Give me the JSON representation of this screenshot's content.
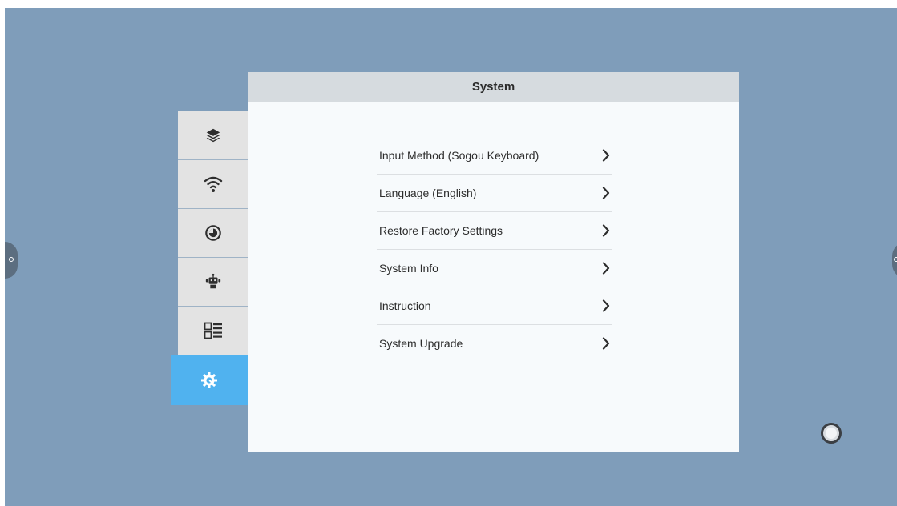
{
  "panel": {
    "title": "System"
  },
  "sidebar": {
    "items": [
      {
        "icon": "layers-icon",
        "active": false
      },
      {
        "icon": "wifi-icon",
        "active": false
      },
      {
        "icon": "clock-icon",
        "active": false
      },
      {
        "icon": "robot-icon",
        "active": false
      },
      {
        "icon": "list-layout-icon",
        "active": false
      },
      {
        "icon": "settings-gear-icon",
        "active": true
      }
    ]
  },
  "menu": {
    "items": [
      {
        "label": "Input Method (Sogou Keyboard)"
      },
      {
        "label": "Language (English)"
      },
      {
        "label": "Restore Factory Settings"
      },
      {
        "label": "System Info"
      },
      {
        "label": "Instruction"
      },
      {
        "label": "System Upgrade"
      }
    ]
  },
  "colors": {
    "desktop": "#7f9dba",
    "active_tab": "#50b2ef",
    "tab_bg": "#e3e3e3",
    "header_bg": "#d6dbdf",
    "panel_bg": "#f7fafc"
  }
}
